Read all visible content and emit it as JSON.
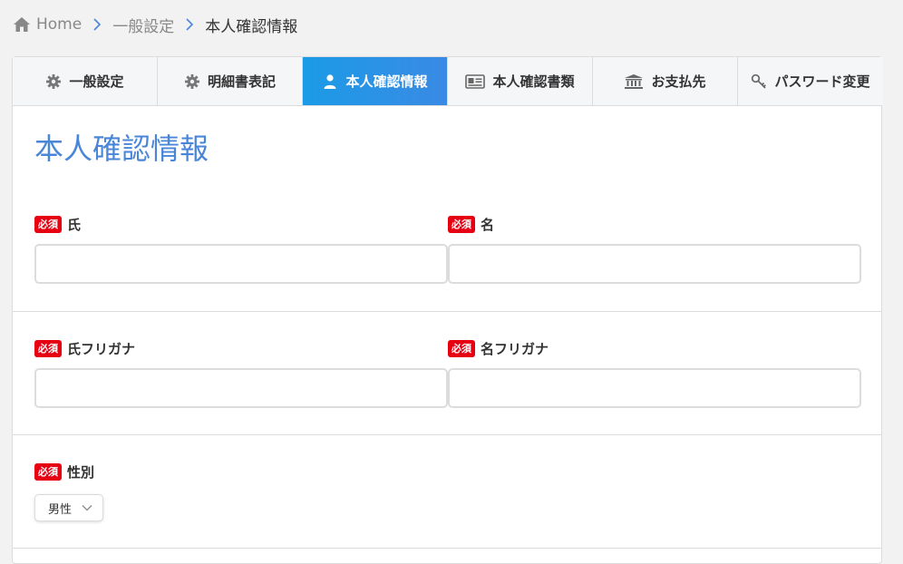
{
  "breadcrumb": {
    "home": "Home",
    "level1": "一般設定",
    "current": "本人確認情報"
  },
  "tabs": [
    {
      "label": "一般設定",
      "icon": "gear-icon",
      "active": false
    },
    {
      "label": "明細書表記",
      "icon": "gear-icon",
      "active": false
    },
    {
      "label": "本人確認情報",
      "icon": "user-icon",
      "active": true
    },
    {
      "label": "本人確認書類",
      "icon": "id-card-icon",
      "active": false
    },
    {
      "label": "お支払先",
      "icon": "bank-icon",
      "active": false
    },
    {
      "label": "パスワード変更",
      "icon": "key-icon",
      "active": false
    }
  ],
  "page_title": "本人確認情報",
  "required_badge": "必須",
  "fields": {
    "last_name": {
      "label": "氏",
      "value": ""
    },
    "first_name": {
      "label": "名",
      "value": ""
    },
    "last_name_kana": {
      "label": "氏フリガナ",
      "value": ""
    },
    "first_name_kana": {
      "label": "名フリガナ",
      "value": ""
    },
    "gender": {
      "label": "性別",
      "selected": "男性"
    }
  },
  "colors": {
    "accent": "#4a86d8",
    "active_tab": "#1b9be6",
    "required": "#e60012"
  }
}
